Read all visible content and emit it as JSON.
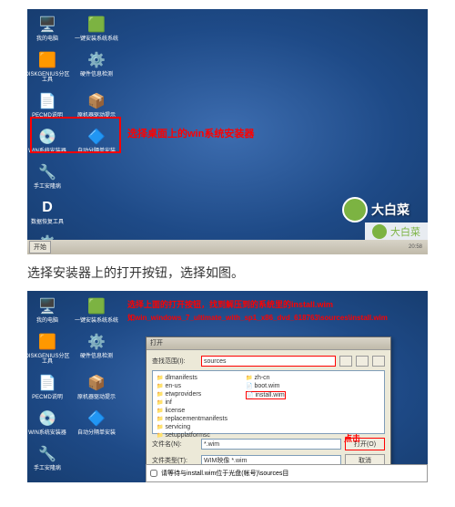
{
  "screenshot1": {
    "icons_col1": [
      "我的电脑",
      "DISKGENIUS分区工具",
      "PECMD说明",
      "WIN系统安装器",
      "手工安隆病",
      "数据恢复工具",
      "系统设置"
    ],
    "icons_col2": [
      "一键安装系统系统",
      "硬件信息检测",
      "原机器驱动提示",
      "自动分隔单安装"
    ],
    "highlight_text": "选择桌面上的win系统安装器",
    "brand": "大白菜",
    "taskbar_start": "开始",
    "taskbar_time": "20:58"
  },
  "instruction": "选择安装器上的打开按钮，选择如图。",
  "screenshot2": {
    "icons_col1": [
      "我的电脑",
      "DISKGENIUS分区工具",
      "PECMD说明",
      "WIN系统安装器",
      "手工安隆病"
    ],
    "icons_col2": [
      "一键安装系统系统",
      "硬件信息检测",
      "原机器驱动提示",
      "自动分隔单安装"
    ],
    "red_line1": "选择上面的打开按钮，找到解压到的系统里的install.wim",
    "red_line2": "如win_windows_7_ultimate_with_sp1_x86_dvd_618763\\sources\\install.wim",
    "click_label": "点击",
    "dialog": {
      "title": "打开",
      "lookin_label": "查找范围(I):",
      "lookin_value": "sources",
      "files_left": [
        "dlmanifests",
        "en-us",
        "etwproviders",
        "inf",
        "license",
        "replacementmanifests",
        "servicing",
        "setupplatformsc"
      ],
      "files_right": [
        "zh-cn",
        "boot.wim",
        "install.wim"
      ],
      "filename_label": "文件名(N):",
      "filename_value": "*.wim",
      "filetype_label": "文件类型(T):",
      "filetype_value": "WIM映像 *.wim",
      "open_btn": "打开(O)",
      "cancel_btn": "取消"
    },
    "bottom_text": "请等待与install.wim位于光盘(帐号)\\sources目"
  }
}
